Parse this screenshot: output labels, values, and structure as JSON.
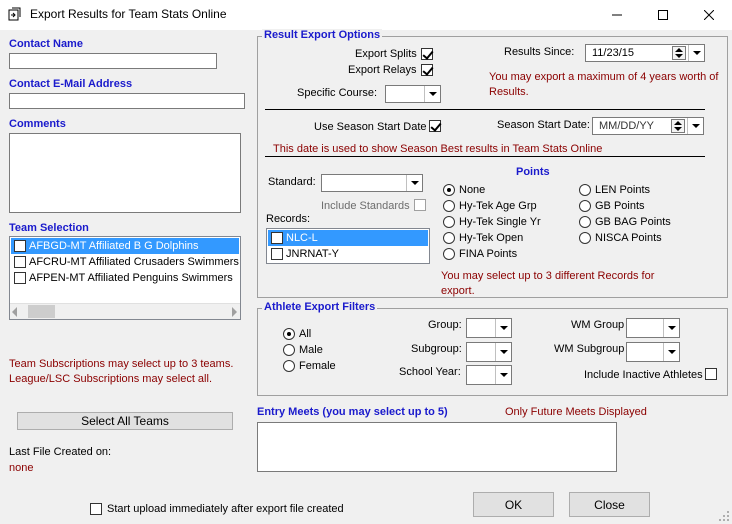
{
  "window": {
    "title": "Export Results for Team Stats Online"
  },
  "contact": {
    "name_label": "Contact Name",
    "name_value": "",
    "email_label": "Contact E-Mail Address",
    "email_value": "",
    "comments_label": "Comments"
  },
  "team_selection": {
    "label": "Team Selection",
    "teams": [
      {
        "label": "AFBGD-MT Affiliated B G Dolphins",
        "selected": true
      },
      {
        "label": "AFCRU-MT Affiliated Crusaders Swimmers",
        "selected": false
      },
      {
        "label": "AFPEN-MT Affiliated Penguins Swimmers",
        "selected": false
      }
    ],
    "note1": "Team Subscriptions may select up to 3 teams.",
    "note2": "League/LSC Subscriptions may select all.",
    "select_all_label": "Select All Teams",
    "last_file_label": "Last File Created on:",
    "last_file_value": "none"
  },
  "result_export": {
    "title": "Result Export Options",
    "export_splits": "Export Splits",
    "export_relays": "Export Relays",
    "specific_course": "Specific Course:",
    "results_since_label": "Results Since:",
    "results_since_value": "11/23/15",
    "max_note": "You may export a maximum of 4 years worth of Results.",
    "use_season_start": "Use Season Start Date",
    "season_start_label": "Season Start Date:",
    "season_start_value": "MM/DD/YY",
    "season_note": "This date is used to show Season Best results in Team Stats Online",
    "standard_label": "Standard:",
    "include_standards": "Include Standards",
    "records_label": "Records:",
    "records": [
      {
        "label": "NLC-L",
        "selected": true
      },
      {
        "label": "JNRNAT-Y",
        "selected": false
      }
    ],
    "records_note": "You may select up to 3 different Records for export.",
    "points_title": "Points",
    "points_left": [
      "None",
      "Hy-Tek Age Grp",
      "Hy-Tek Single Yr",
      "Hy-Tek Open",
      "FINA Points"
    ],
    "points_right": [
      "LEN Points",
      "GB Points",
      "GB BAG Points",
      "NISCA Points"
    ],
    "points_selected": "None"
  },
  "athlete_filters": {
    "title": "Athlete Export Filters",
    "gender": [
      "All",
      "Male",
      "Female"
    ],
    "gender_selected": "All",
    "group_label": "Group:",
    "subgroup_label": "Subgroup:",
    "school_year_label": "School Year:",
    "wm_group_label": "WM Group",
    "wm_subgroup_label": "WM Subgroup",
    "include_inactive": "Include Inactive Athletes"
  },
  "entry_meets": {
    "label": "Entry Meets (you may select up to 5)",
    "future_note": "Only Future Meets Displayed"
  },
  "footer": {
    "start_upload": "Start upload immediately after export file created",
    "ok_label": "OK",
    "close_label": "Close"
  }
}
